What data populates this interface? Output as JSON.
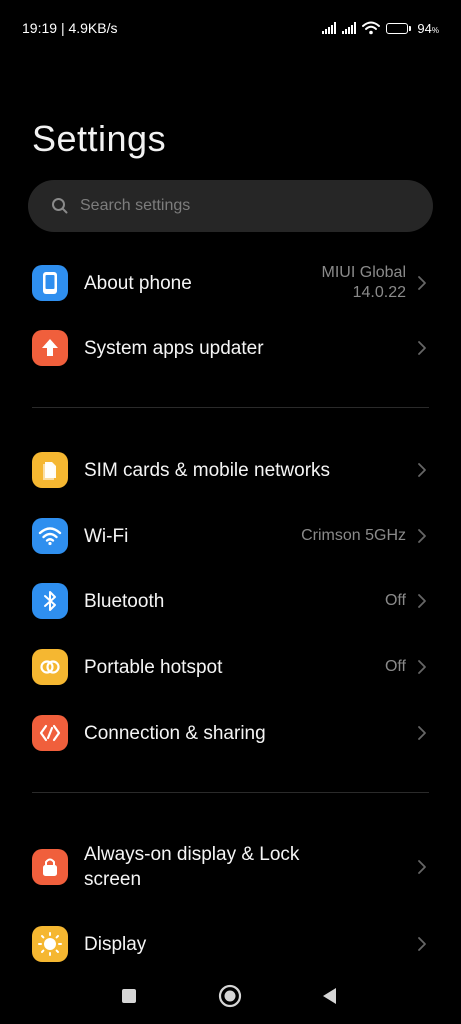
{
  "status": {
    "time": "19:19",
    "net_speed": "4.9KB/s",
    "battery": "94",
    "battery_level": 0.94
  },
  "page_title": "Settings",
  "search": {
    "placeholder": "Search settings"
  },
  "groups": [
    {
      "items": [
        {
          "label": "About phone",
          "value_line1": "MIUI Global",
          "value_line2": "14.0.22",
          "icon": "phone-icon",
          "color": "#2f8fef"
        },
        {
          "label": "System apps updater",
          "icon": "arrow-up-icon",
          "color": "#f05f3c"
        }
      ]
    },
    {
      "items": [
        {
          "label": "SIM cards & mobile networks",
          "icon": "sim-card-icon",
          "color": "#f5b731"
        },
        {
          "label": "Wi-Fi",
          "value": "Crimson 5GHz",
          "icon": "wifi-icon",
          "color": "#2f8fef"
        },
        {
          "label": "Bluetooth",
          "value": "Off",
          "icon": "bluetooth-icon",
          "color": "#2f8fef"
        },
        {
          "label": "Portable hotspot",
          "value": "Off",
          "icon": "hotspot-icon",
          "color": "#f5b731"
        },
        {
          "label": "Connection & sharing",
          "icon": "sharing-icon",
          "color": "#f05f3c"
        }
      ]
    },
    {
      "items": [
        {
          "label": "Always-on display & Lock screen",
          "label_line1": "Always-on display & Lock",
          "label_line2": "screen",
          "icon": "lock-icon",
          "color": "#f05f3c"
        },
        {
          "label": "Display",
          "icon": "sun-icon",
          "color": "#f5b731"
        }
      ]
    }
  ],
  "nav": {
    "recents": "square-icon",
    "home": "circle-icon",
    "back": "triangle-back-icon"
  }
}
